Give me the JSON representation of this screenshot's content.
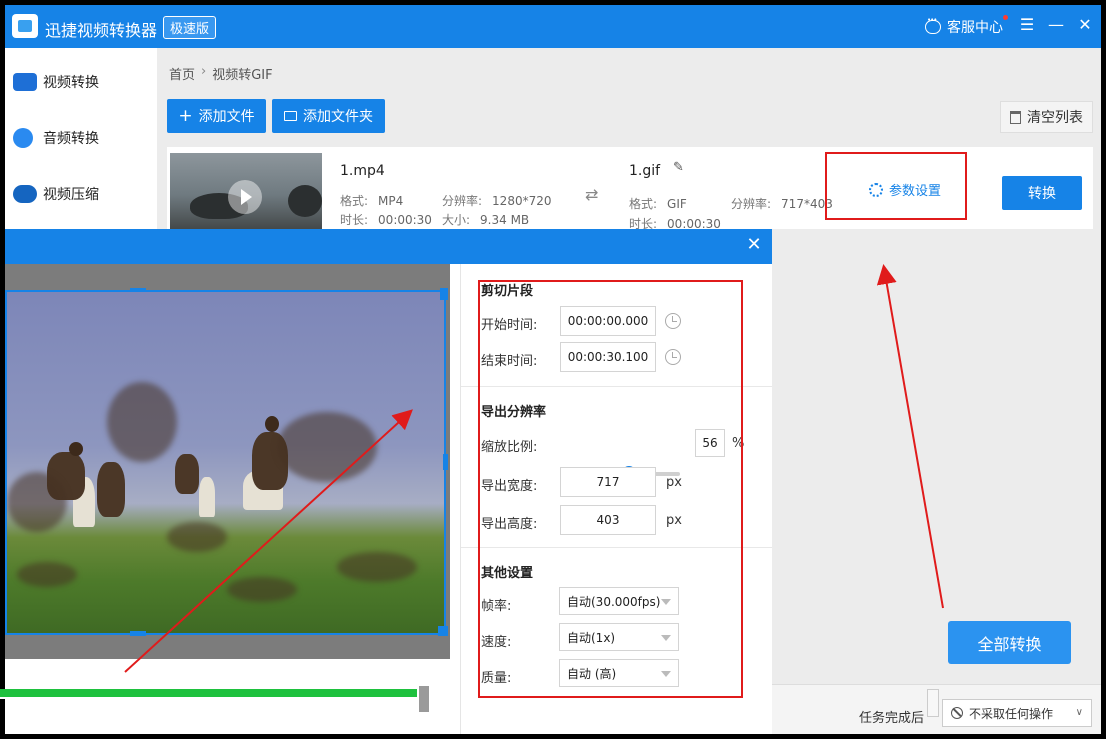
{
  "titlebar": {
    "app_title": "迅捷视频转换器",
    "edition": "极速版",
    "support": "客服中心",
    "menu_glyph": "☰",
    "minimize_glyph": "—",
    "close_glyph": "✕"
  },
  "sidebar": {
    "items": [
      {
        "label": "视频转换",
        "icon": "video-convert-icon"
      },
      {
        "label": "音频转换",
        "icon": "audio-convert-icon"
      },
      {
        "label": "视频压缩",
        "icon": "video-compress-icon"
      }
    ]
  },
  "breadcrumb": {
    "home": "首页",
    "separator": "›",
    "current": "视频转GIF"
  },
  "toolbar": {
    "add_file": "添加文件",
    "add_folder": "添加文件夹",
    "clear_list": "清空列表"
  },
  "file": {
    "source_name": "1.mp4",
    "format_label": "格式:",
    "format": "MP4",
    "resolution_label": "分辨率:",
    "resolution": "1280*720",
    "duration_label": "时长:",
    "duration": "00:00:30",
    "size_label": "大小:",
    "size": "9.34 MB",
    "output_name": "1.gif",
    "output_format": "GIF",
    "output_resolution": "717*403",
    "output_duration": "00:00:30",
    "param_settings": "参数设置",
    "convert": "转换"
  },
  "bottom": {
    "convert_all": "全部转换",
    "after_task_label": "任务完成后",
    "after_task_value": "不采取任何操作"
  },
  "dialog": {
    "close_glyph": "✕",
    "preview_progress": 0.97,
    "clip": {
      "title": "剪切片段",
      "start_label": "开始时间:",
      "start_value": "00:00:00.000",
      "end_label": "结束时间:",
      "end_value": "00:00:30.100"
    },
    "resolution": {
      "title": "导出分辨率",
      "scale_label": "缩放比例:",
      "scale_value": "56",
      "scale_unit": "%",
      "scale_fraction": 0.56,
      "width_label": "导出宽度:",
      "width_value": "717",
      "height_label": "导出高度:",
      "height_value": "403",
      "px": "px"
    },
    "other": {
      "title": "其他设置",
      "fps_label": "帧率:",
      "fps_value": "自动(30.000fps)",
      "speed_label": "速度:",
      "speed_value": "自动(1x)",
      "quality_label": "质量:",
      "quality_value": "自动 (高)"
    }
  },
  "colors": {
    "accent": "#1683e7",
    "annotation_red": "#e01b1b",
    "progress_green": "#1ec13e"
  }
}
